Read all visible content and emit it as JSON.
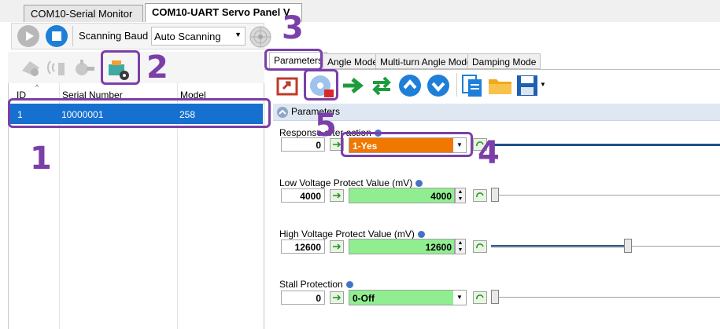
{
  "tabs": [
    {
      "label": "COM10-Serial Monitor"
    },
    {
      "label": "COM10-UART Servo Panel V"
    }
  ],
  "toolbar": {
    "scanning_baud_label": "Scanning Baud",
    "baud_value": "Auto Scanning"
  },
  "device_table": {
    "headers": [
      "ID",
      "Serial Number",
      "Model"
    ],
    "rows": [
      {
        "id": "1",
        "serial": "10000001",
        "model": "258"
      }
    ]
  },
  "panel_tabs": [
    "Parameters",
    "Angle Mode",
    "Multi-turn Angle Mode",
    "Damping Mode"
  ],
  "section_title": "Parameters",
  "params": {
    "response": {
      "label": "Response after action",
      "value": "0",
      "selected": "1-Yes"
    },
    "low_voltage": {
      "label": "Low Voltage Protect Value (mV)",
      "value": "4000",
      "field": "4000",
      "slider_level": 0.0
    },
    "high_voltage": {
      "label": "High Voltage Protect Value (mV)",
      "value": "12600",
      "field": "12600",
      "slider_level": 0.6
    },
    "stall": {
      "label": "Stall Protection",
      "value": "0",
      "selected": "0-Off"
    }
  },
  "annotations": [
    "1",
    "2",
    "3",
    "4",
    "5"
  ],
  "colors": {
    "accent": "#7b3fa8",
    "selection": "#1570d0",
    "orange": "#f07800",
    "green": "#90ee90"
  }
}
